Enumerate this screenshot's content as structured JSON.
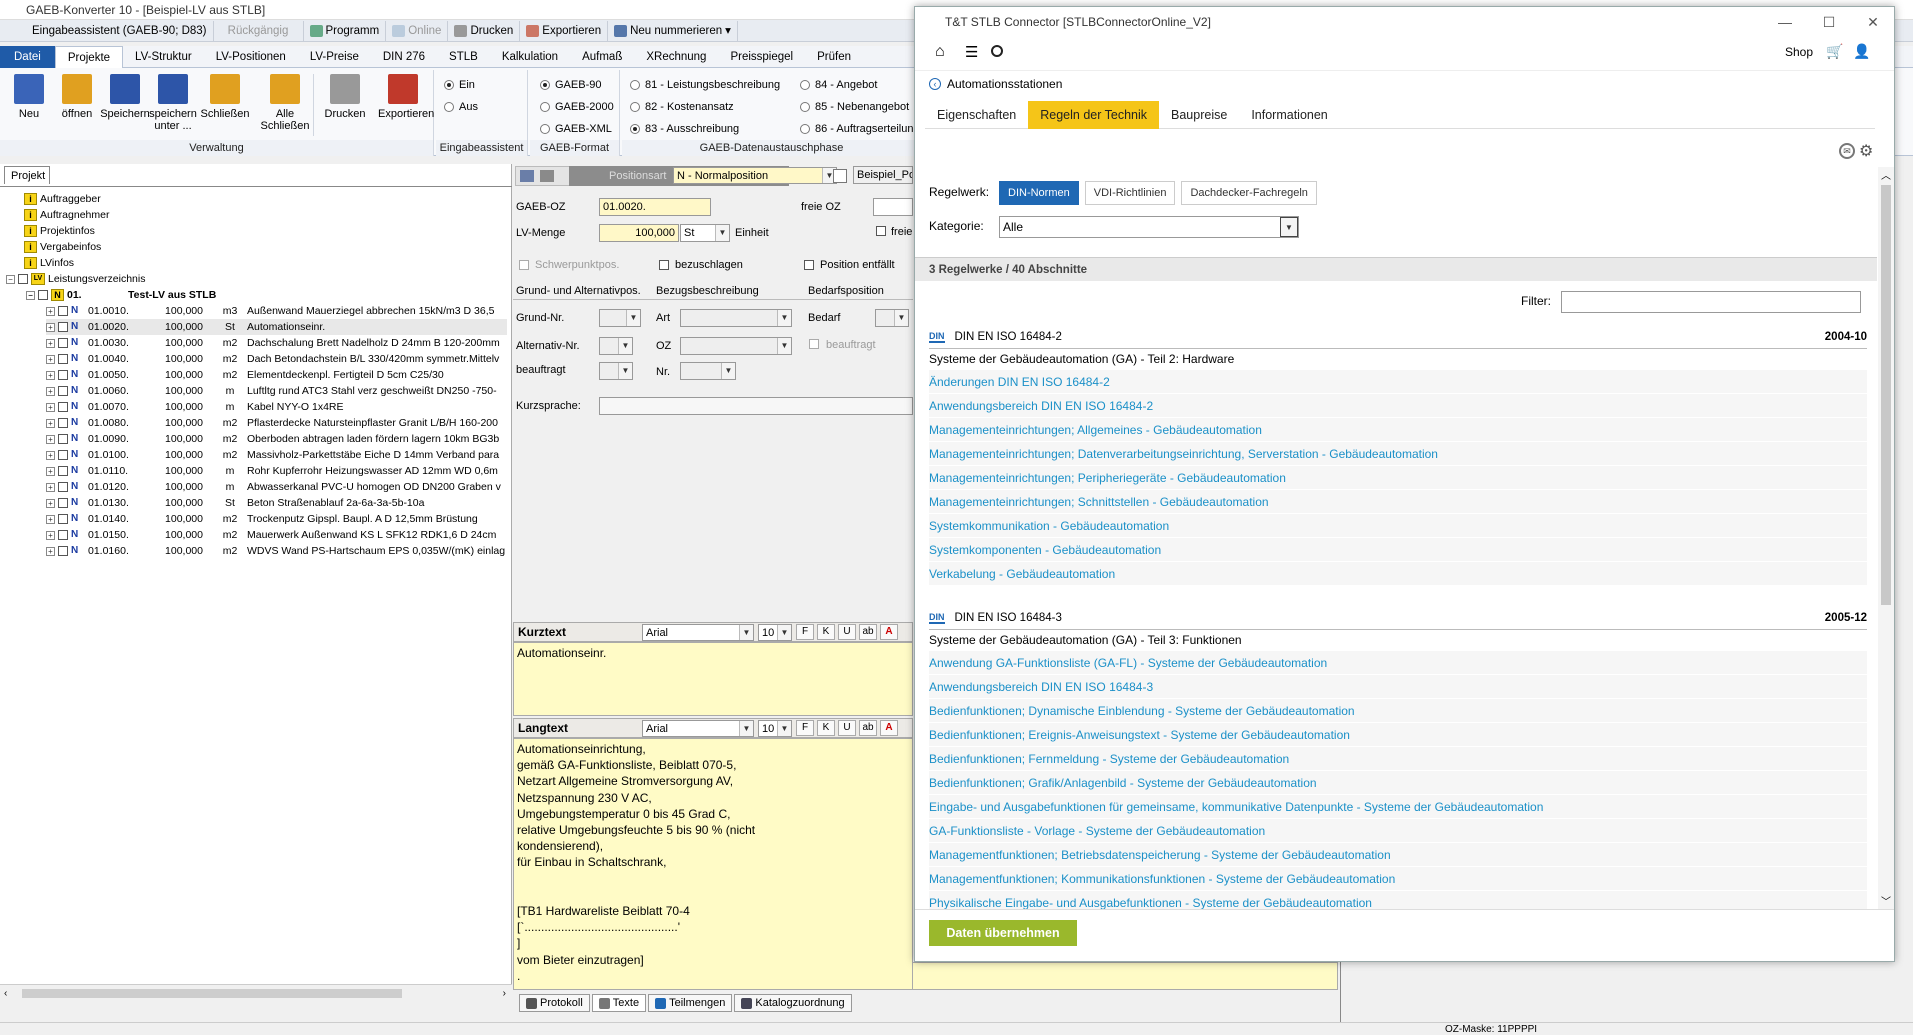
{
  "app": {
    "title": "GAEB-Konverter 10 - [Beispiel-LV aus STLB]",
    "quickbar": {
      "assistant": "Eingabeassistent (GAEB-90; D83)",
      "undo": "Rückgängig",
      "program": "Programm",
      "online": "Online",
      "print": "Drucken",
      "export": "Exportieren",
      "renumber": "Neu nummerieren"
    },
    "ribbon_tabs": [
      "Datei",
      "Projekte",
      "LV-Struktur",
      "LV-Positionen",
      "LV-Preise",
      "DIN 276",
      "STLB",
      "Kalkulation",
      "Aufmaß",
      "XRechnung",
      "Preisspiegel",
      "Prüfen"
    ],
    "ribbon": {
      "verwaltung": {
        "label": "Verwaltung",
        "buttons": [
          "Neu",
          "öffnen",
          "Speichern",
          "speichern unter ...",
          "Schließen",
          "Alle Schließen",
          "Drucken",
          "Exportieren"
        ]
      },
      "eingabe": {
        "label": "Eingabeassistent",
        "on": "Ein",
        "off": "Aus"
      },
      "format": {
        "label": "GAEB-Format",
        "options": [
          "GAEB-90",
          "GAEB-2000",
          "GAEB-XML"
        ]
      },
      "dta": {
        "label": "GAEB-Datenaustauschphase",
        "options": [
          "81 - Leistungsbeschreibung",
          "82 - Kostenansatz",
          "83 - Ausschreibung",
          "84 - Angebot",
          "85 - Nebenangebot",
          "86 - Auftragserteilung"
        ]
      }
    },
    "tree": {
      "tab": "Projekt",
      "nodes": [
        "Auftraggeber",
        "Auftragnehmer",
        "Projektinfos",
        "Vergabeinfos",
        "LVinfos"
      ],
      "lv": "Leistungsverzeichnis",
      "group_oz": "01.",
      "group_title": "Test-LV aus STLB",
      "positions": [
        {
          "oz": "01.0010.",
          "qty": "100,000",
          "unit": "m3",
          "text": "Außenwand Mauerziegel abbrechen 15kN/m3 D 36,5"
        },
        {
          "oz": "01.0020.",
          "qty": "100,000",
          "unit": "St",
          "text": "Automationseinr."
        },
        {
          "oz": "01.0030.",
          "qty": "100,000",
          "unit": "m2",
          "text": "Dachschalung Brett Nadelholz D 24mm B 120-200mm"
        },
        {
          "oz": "01.0040.",
          "qty": "100,000",
          "unit": "m2",
          "text": "Dach Betondachstein B/L 330/420mm symmetr.Mittelv"
        },
        {
          "oz": "01.0050.",
          "qty": "100,000",
          "unit": "m2",
          "text": "Elementdeckenpl. Fertigteil D 5cm C25/30"
        },
        {
          "oz": "01.0060.",
          "qty": "100,000",
          "unit": "m",
          "text": "Luftltg rund ATC3 Stahl verz geschweißt DN250 -750-"
        },
        {
          "oz": "01.0070.",
          "qty": "100,000",
          "unit": "m",
          "text": "Kabel NYY-O 1x4RE"
        },
        {
          "oz": "01.0080.",
          "qty": "100,000",
          "unit": "m2",
          "text": "Pflasterdecke Natursteinpflaster Granit L/B/H 160-200"
        },
        {
          "oz": "01.0090.",
          "qty": "100,000",
          "unit": "m2",
          "text": "Oberboden abtragen laden fördern lagern 10km BG3b"
        },
        {
          "oz": "01.0100.",
          "qty": "100,000",
          "unit": "m2",
          "text": "Massivholz-Parkettstäbe Eiche D 14mm Verband para"
        },
        {
          "oz": "01.0110.",
          "qty": "100,000",
          "unit": "m",
          "text": "Rohr Kupferrohr Heizungswasser AD 12mm WD 0,6m"
        },
        {
          "oz": "01.0120.",
          "qty": "100,000",
          "unit": "m",
          "text": "Abwasserkanal PVC-U homogen OD DN200 Graben v"
        },
        {
          "oz": "01.0130.",
          "qty": "100,000",
          "unit": "St",
          "text": "Beton Straßenablauf 2a-6a-3a-5b-10a"
        },
        {
          "oz": "01.0140.",
          "qty": "100,000",
          "unit": "m2",
          "text": "Trockenputz Gipspl. Baupl. A D 12,5mm Brüstung"
        },
        {
          "oz": "01.0150.",
          "qty": "100,000",
          "unit": "m2",
          "text": "Mauerwerk Außenwand KS L SFK12 RDK1,6 D 24cm"
        },
        {
          "oz": "01.0160.",
          "qty": "100,000",
          "unit": "m2",
          "text": "WDVS Wand PS-Hartschaum EPS 0,035W/(mK) einlag"
        }
      ]
    },
    "form": {
      "positionsart_label": "Positionsart",
      "positionsart_value": "N - Normalposition",
      "beispiel": "Beispiel_Po",
      "gaeb_oz_label": "GAEB-OZ",
      "gaeb_oz_value": "01.0020.",
      "freie_oz_label": "freie OZ",
      "lv_menge_label": "LV-Menge",
      "lv_menge_value": "100,000",
      "unit_value": "St",
      "einheit_label": "Einheit",
      "freie": "freie",
      "schwerpunkt": "Schwerpunktpos.",
      "bezuschlagen": "bezuschlagen",
      "entfaellt": "Position entfällt",
      "col1": "Grund- und Alternativpos.",
      "col2": "Bezugsbeschreibung",
      "col3": "Bedarfsposition",
      "grund_nr": "Grund-Nr.",
      "art": "Art",
      "bedarf": "Bedarf",
      "alternativ_nr": "Alternativ-Nr.",
      "oz": "OZ",
      "beauftragt_dis": "beauftragt",
      "beauftragt": "beauftragt",
      "nr": "Nr.",
      "kurzsprache": "Kurzsprache:"
    },
    "kurztext": {
      "label": "Kurztext",
      "font": "Arial",
      "size": "10",
      "text": "Automationseinr."
    },
    "langtext": {
      "label": "Langtext",
      "font": "Arial",
      "size": "10",
      "text": "Automationseinrichtung,\ngemäß GA-Funktionsliste, Beiblatt 070-5,\nNetzart Allgemeine Stromversorgung AV,\nNetzspannung 230 V AC,\nUmgebungstemperatur 0 bis 45 Grad C,\nrelative Umgebungsfeuchte 5 bis 90 % (nicht\nkondensierend),\nfür Einbau in Schaltschrank,\n\n\n[TB1 Hardwareliste Beiblatt 70-4\n[`..............................................'\n]\nvom Bieter einzutragen]\n."
    },
    "fmt_buttons": [
      "F",
      "K",
      "U",
      "ab",
      "A"
    ],
    "bottom_tabs": [
      "Protokoll",
      "Texte",
      "Teilmengen",
      "Katalogzuordnung"
    ],
    "status": "OZ-Maske: 11PPPPI"
  },
  "popup": {
    "title": "T&T STLB Connector [STLBConnectorOnline_V2]",
    "shop": "Shop",
    "breadcrumb": "Automationsstationen",
    "tabs": [
      "Eigenschaften",
      "Regeln der Technik",
      "Baupreise",
      "Informationen"
    ],
    "regelwerk_label": "Regelwerk:",
    "regelwerk_buttons": [
      "DIN-Normen",
      "VDI-Richtlinien",
      "Dachdecker-Fachregeln"
    ],
    "kategorie_label": "Kategorie:",
    "kategorie_value": "Alle",
    "summary": "3 Regelwerke / 40 Abschnitte",
    "filter_label": "Filter:",
    "din_badge": "DIN",
    "norms": [
      {
        "id": "DIN EN ISO 16484-2",
        "date": "2004-10",
        "subtitle": "Systeme der Gebäudeautomation (GA) - Teil 2: Hardware",
        "sections": [
          "Änderungen DIN EN ISO 16484-2",
          "Anwendungsbereich DIN EN ISO 16484-2",
          "Managementeinrichtungen; Allgemeines - Gebäudeautomation",
          "Managementeinrichtungen; Datenverarbeitungseinrichtung, Serverstation - Gebäudeautomation",
          "Managementeinrichtungen; Peripheriegeräte - Gebäudeautomation",
          "Managementeinrichtungen; Schnittstellen - Gebäudeautomation",
          "Systemkommunikation - Gebäudeautomation",
          "Systemkomponenten - Gebäudeautomation",
          "Verkabelung - Gebäudeautomation"
        ]
      },
      {
        "id": "DIN EN ISO 16484-3",
        "date": "2005-12",
        "subtitle": "Systeme der Gebäudeautomation (GA) - Teil 3: Funktionen",
        "sections": [
          "Anwendung GA-Funktionsliste (GA-FL) - Systeme der Gebäudeautomation",
          "Anwendungsbereich DIN EN ISO 16484-3",
          "Bedienfunktionen; Dynamische Einblendung - Systeme der Gebäudeautomation",
          "Bedienfunktionen; Ereignis-Anweisungstext - Systeme der Gebäudeautomation",
          "Bedienfunktionen; Fernmeldung - Systeme der Gebäudeautomation",
          "Bedienfunktionen; Grafik/Anlagenbild - Systeme der Gebäudeautomation",
          "Eingabe- und Ausgabefunktionen für gemeinsame, kommunikative Datenpunkte - Systeme der Gebäudeautomation",
          "GA-Funktionsliste - Vorlage - Systeme der Gebäudeautomation",
          "Managementfunktionen; Betriebsdatenspeicherung - Systeme der Gebäudeautomation",
          "Managementfunktionen; Kommunikationsfunktionen - Systeme der Gebäudeautomation",
          "Physikalische Eingabe- und Ausgabefunktionen - Systeme der Gebäudeautomation"
        ]
      }
    ],
    "take_button": "Daten übernehmen"
  }
}
